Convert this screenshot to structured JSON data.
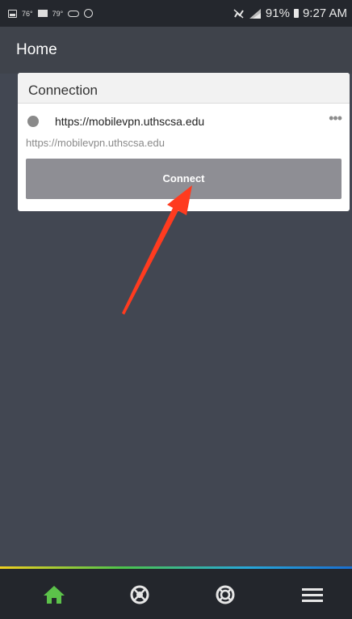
{
  "status_bar": {
    "temp_1": "76°",
    "temp_2": "79°",
    "battery": "91%",
    "time": "9:27 AM"
  },
  "header": {
    "title": "Home"
  },
  "connection_card": {
    "title": "Connection",
    "url": "https://mobilevpn.uthscsa.edu",
    "subtitle": "https://mobilevpn.uthscsa.edu",
    "more_label": "•••",
    "connect_label": "Connect"
  },
  "tab_bar": {
    "tabs": [
      "home-icon",
      "network-icon",
      "support-icon",
      "menu-icon"
    ],
    "active_color": "#5cc24a"
  },
  "colors": {
    "annotation_arrow": "#ff3b1f"
  }
}
